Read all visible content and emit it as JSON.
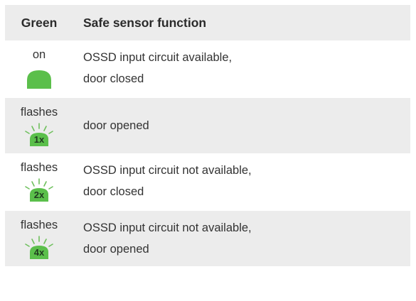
{
  "table": {
    "header": {
      "col1": "Green",
      "col2": "Safe sensor function"
    },
    "rows": [
      {
        "state": "on",
        "led": "led-steady-icon",
        "count": "",
        "lines": [
          "OSSD input circuit available,",
          "door closed"
        ]
      },
      {
        "state": "flashes",
        "led": "led-flashing-icon",
        "count": "1x",
        "lines": [
          "door opened"
        ]
      },
      {
        "state": "flashes",
        "led": "led-flashing-icon",
        "count": "2x",
        "lines": [
          "OSSD input circuit not available,",
          "door closed"
        ]
      },
      {
        "state": "flashes",
        "led": "led-flashing-icon",
        "count": "4x",
        "lines": [
          "OSSD input circuit not available,",
          "door opened"
        ]
      }
    ]
  },
  "colors": {
    "header_bg": "#ececec",
    "row_shade": "#ececec",
    "led_fill": "#5bbf4b",
    "led_ray": "#6fc05d"
  }
}
